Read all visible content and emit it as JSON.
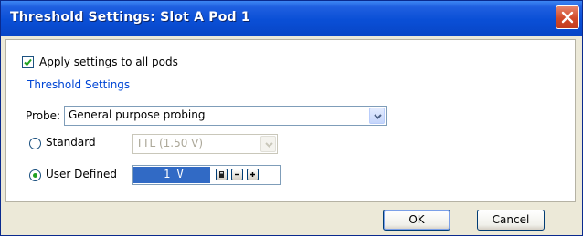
{
  "window": {
    "title": "Threshold Settings: Slot A Pod 1",
    "close_icon": "close-icon"
  },
  "apply_all": {
    "label": "Apply settings to all pods",
    "checked": true
  },
  "group": {
    "title": "Threshold Settings"
  },
  "probe": {
    "label": "Probe:",
    "value": "General purpose probing"
  },
  "standard": {
    "label": "Standard",
    "selected": false,
    "value": "TTL (1.50 V)",
    "enabled": false
  },
  "user_defined": {
    "label": "User Defined",
    "selected": true,
    "value": "1 V",
    "icons": [
      "calculator-icon",
      "minus-icon",
      "plus-icon"
    ]
  },
  "buttons": {
    "ok": "OK",
    "cancel": "Cancel"
  },
  "colors": {
    "titlebar": "#0a4fd6",
    "accent": "#316ac5",
    "group_title": "#0046d5",
    "close": "#d14a2a"
  }
}
